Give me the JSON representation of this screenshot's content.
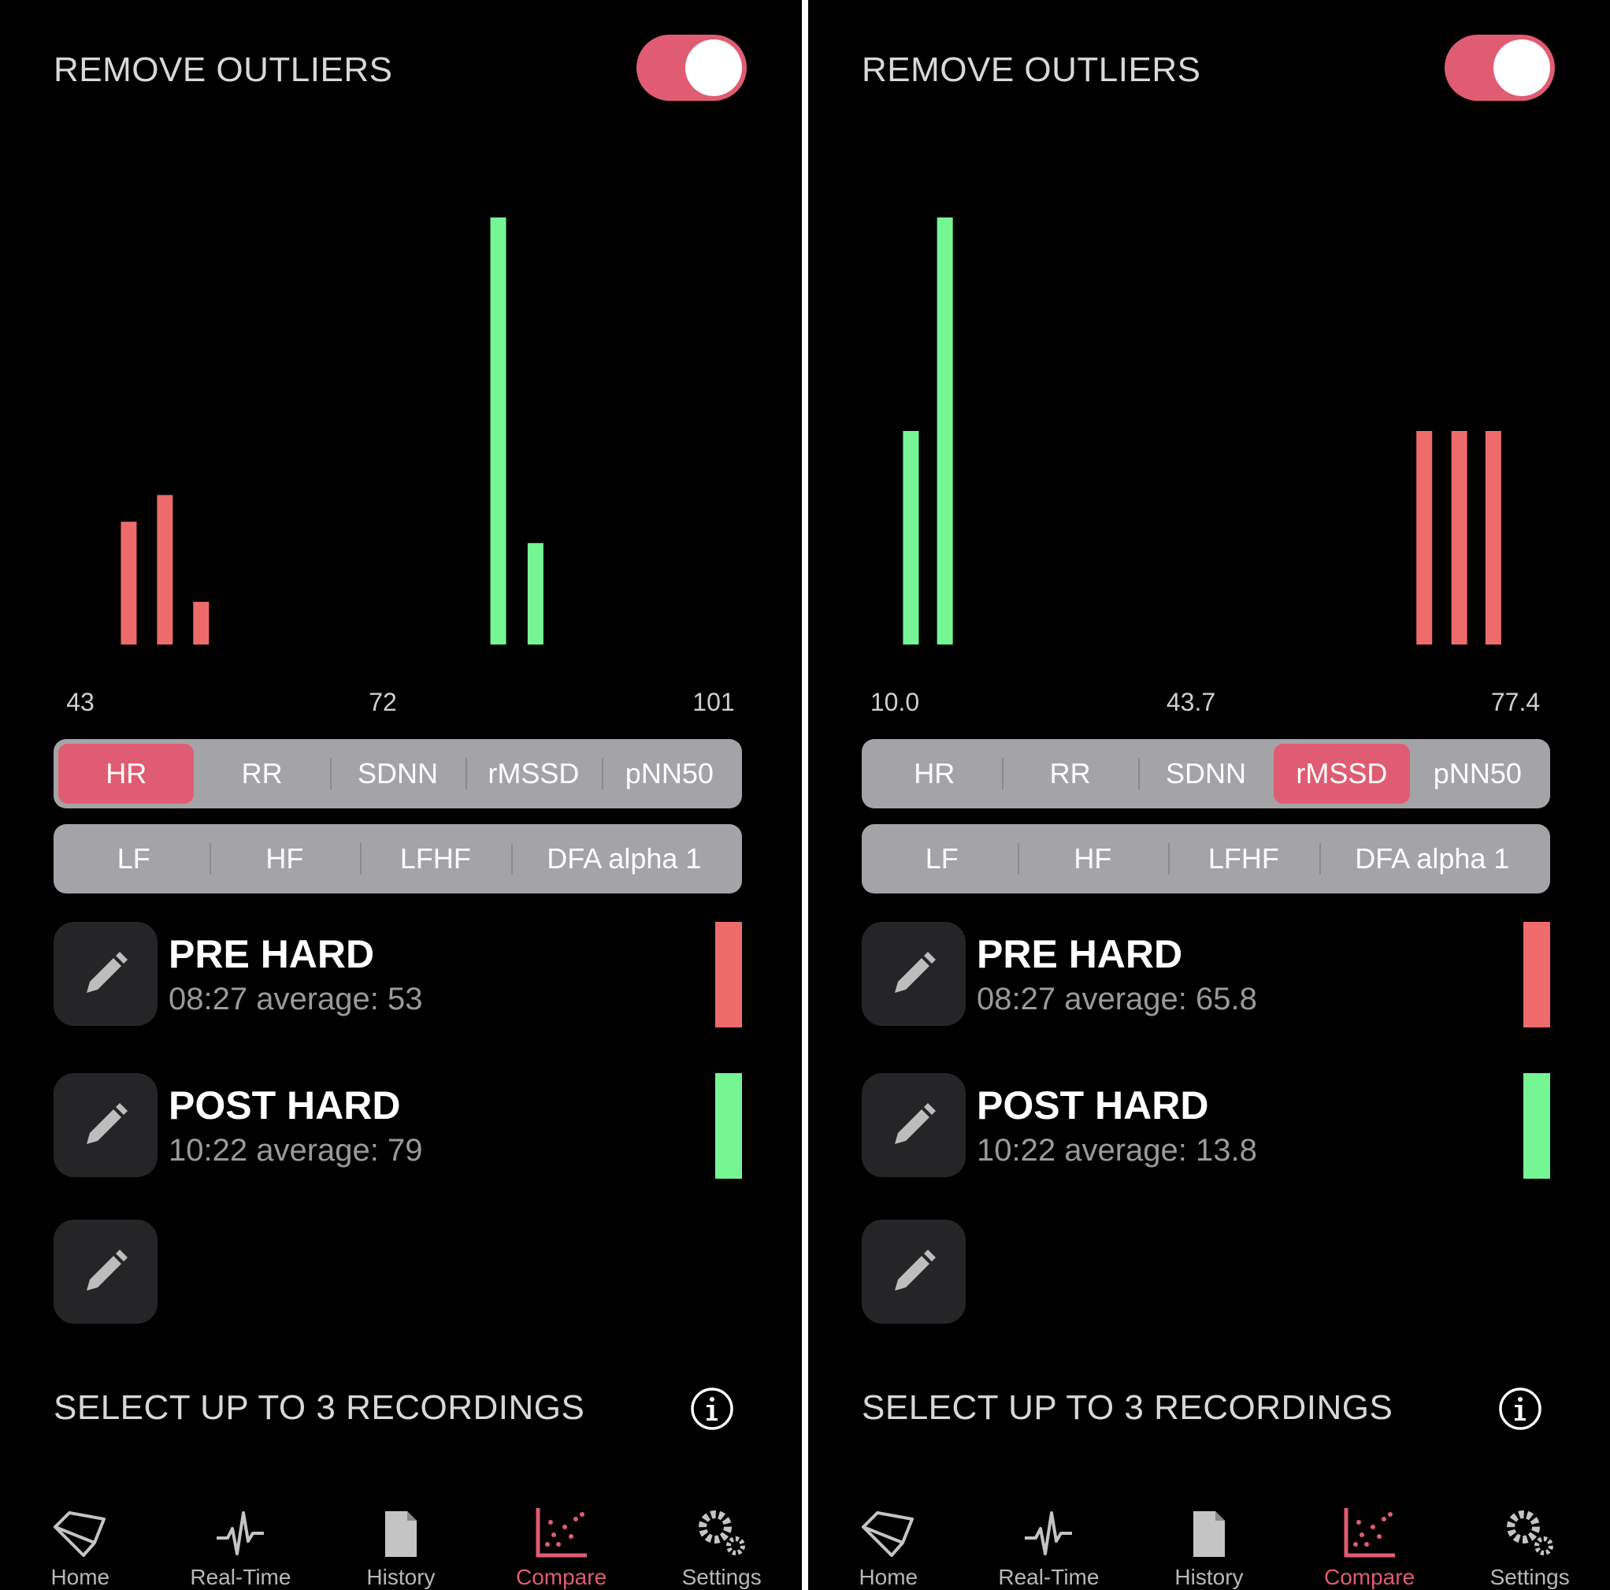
{
  "panels": [
    {
      "remove_outliers_label": "REMOVE OUTLIERS",
      "remove_outliers_on": true,
      "chart_data": {
        "type": "histogram",
        "metric": "HR",
        "x_ticks": [
          "43",
          "72",
          "101"
        ],
        "xlim": [
          43,
          101
        ],
        "grid": false,
        "series": [
          {
            "color": "#ee6b6b",
            "bins": [
              {
                "x": 48.4,
                "count": 2.3
              },
              {
                "x": 51.6,
                "count": 2.8
              },
              {
                "x": 54.8,
                "count": 0.8
              }
            ]
          },
          {
            "color": "#76f595",
            "bins": [
              {
                "x": 81.1,
                "count": 8.0
              },
              {
                "x": 84.4,
                "count": 1.9
              }
            ]
          }
        ]
      },
      "metrics_row1": [
        "HR",
        "RR",
        "SDNN",
        "rMSSD",
        "pNN50"
      ],
      "metrics_row2": [
        "LF",
        "HF",
        "LFHF",
        "DFA alpha 1"
      ],
      "selected_metric": "HR",
      "recordings": [
        {
          "title": "PRE HARD",
          "subtitle": "08:27 average: 53",
          "color": "#ee6b6b"
        },
        {
          "title": "POST HARD",
          "subtitle": "10:22 average: 79",
          "color": "#76f595"
        },
        {
          "title": "",
          "subtitle": "",
          "color": ""
        }
      ],
      "select_label": "SELECT UP TO 3 RECORDINGS",
      "tabs": [
        {
          "label": "Home",
          "icon": "heart-icon"
        },
        {
          "label": "Real-Time",
          "icon": "pulse-icon"
        },
        {
          "label": "History",
          "icon": "document-icon"
        },
        {
          "label": "Compare",
          "icon": "scatter-chart-icon",
          "active": true
        },
        {
          "label": "Settings",
          "icon": "gears-icon"
        }
      ]
    },
    {
      "remove_outliers_label": "REMOVE OUTLIERS",
      "remove_outliers_on": true,
      "chart_data": {
        "type": "histogram",
        "metric": "rMSSD",
        "x_ticks": [
          "10.0",
          "43.7",
          "77.4"
        ],
        "xlim": [
          10.0,
          77.4
        ],
        "grid": false,
        "series": [
          {
            "color": "#76f595",
            "bins": [
              {
                "x": 13.6,
                "count": 4.0
              },
              {
                "x": 17.1,
                "count": 8.0
              }
            ]
          },
          {
            "color": "#ee6b6b",
            "bins": [
              {
                "x": 66.4,
                "count": 4.0
              },
              {
                "x": 70.0,
                "count": 4.0
              },
              {
                "x": 73.5,
                "count": 4.0
              }
            ]
          }
        ]
      },
      "metrics_row1": [
        "HR",
        "RR",
        "SDNN",
        "rMSSD",
        "pNN50"
      ],
      "metrics_row2": [
        "LF",
        "HF",
        "LFHF",
        "DFA alpha 1"
      ],
      "selected_metric": "rMSSD",
      "recordings": [
        {
          "title": "PRE HARD",
          "subtitle": "08:27 average: 65.8",
          "color": "#ee6b6b"
        },
        {
          "title": "POST HARD",
          "subtitle": "10:22 average: 13.8",
          "color": "#76f595"
        },
        {
          "title": "",
          "subtitle": "",
          "color": ""
        }
      ],
      "select_label": "SELECT UP TO 3 RECORDINGS",
      "tabs": [
        {
          "label": "Home",
          "icon": "heart-icon"
        },
        {
          "label": "Real-Time",
          "icon": "pulse-icon"
        },
        {
          "label": "History",
          "icon": "document-icon"
        },
        {
          "label": "Compare",
          "icon": "scatter-chart-icon",
          "active": true
        },
        {
          "label": "Settings",
          "icon": "gears-icon"
        }
      ]
    }
  ]
}
